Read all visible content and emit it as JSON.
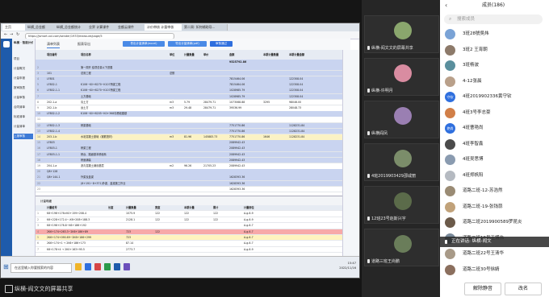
{
  "shared_screen": {
    "caption": "纵横-阎文文的屏幕共享",
    "browser": {
      "tabs": [
        "主页",
        "纵横_总金额",
        "纵横_总金额统计",
        "业界 计算课件",
        "金额云课件",
        "计价审核 计量审核",
        "第二周: 如何辅助导..."
      ],
      "url": "https://jsmart.xxl.com/sender/1933/measure/page/5"
    },
    "app": {
      "title": "纵横 · 智能计价",
      "sidebar": [
        "项目",
        "计量概况",
        "计量申报",
        "报审报表",
        "计量审核",
        "合同清单",
        "标准清单",
        "计量清单",
        "上报审核"
      ],
      "toolbar": {
        "tabs": [
          "清单列表",
          "报表导出"
        ],
        "buttons": [
          "导出计量清单(excel)",
          "导出计量清单(pdf)",
          "审核通过"
        ]
      },
      "grid": {
        "headers": [
          "项目编号",
          "项目名称",
          "单位",
          "计量数量",
          "单价",
          "金额",
          "本期计量数量",
          "本期计量金额"
        ],
        "total": "9525792.86",
        "rows": [
          {
            "code": "",
            "name": "第一周开 结项总量以下进展",
            "unit": "",
            "qty": "",
            "price": "",
            "amount": "",
            "cur": "",
            "cur_amt": "",
            "style": "blue"
          },
          {
            "code": "101",
            "name": "总则工程",
            "unit": "总额",
            "qty": "",
            "price": "",
            "amount": "",
            "cur": "",
            "cur_amt": "",
            "style": "blue"
          },
          {
            "code": "LF801",
            "name": "",
            "unit": "",
            "qty": "",
            "price": "",
            "amount": "7815464.06",
            "cur": "",
            "cur_amt": "122308.04",
            "style": "blue"
          },
          {
            "code": "LF802-1",
            "name": "K106~K0+6270~K107桥梁工程",
            "unit": "",
            "qty": "",
            "price": "",
            "amount": "7815464.06",
            "cur": "",
            "cur_amt": "122308.04",
            "style": "blue"
          },
          {
            "code": "LF802-1-1",
            "name": "K106~K0+6270~K107桥梁工程",
            "unit": "",
            "qty": "",
            "price": "",
            "amount": "1028985.79",
            "cur": "",
            "cur_amt": "122308.04",
            "style": "blue"
          },
          {
            "code": "",
            "name": "土方基础",
            "unit": "",
            "qty": "",
            "price": "",
            "amount": "1028985.79",
            "cur": "",
            "cur_amt": "122308.04",
            "style": "blue"
          },
          {
            "code": "202-1-a",
            "name": "清土方",
            "unit": "m3",
            "qty": "5.79",
            "price": "28479.71",
            "amount": "1073068.88",
            "cur": "3295",
            "cur_amt": "98046.00",
            "style": "white"
          },
          {
            "code": "202-1-b",
            "name": "运土方",
            "unit": "m3",
            "qty": "29.48",
            "price": "28479.71",
            "amount": "39536.99",
            "cur": "",
            "cur_amt": "28048.73",
            "style": "white"
          },
          {
            "code": "LF802-1-2",
            "name": "K106~K0+6205~K0+368沟槽段路基",
            "unit": "",
            "qty": "",
            "price": "",
            "amount": "",
            "cur": "",
            "cur_amt": "",
            "style": "blue"
          },
          {
            "code": "",
            "name": "",
            "unit": "",
            "qty": "",
            "price": "",
            "amount": "",
            "cur": "",
            "cur_amt": "",
            "style": "white"
          },
          {
            "code": "LF802-1-3",
            "name": "桥梁基础",
            "unit": "",
            "qty": "",
            "price": "",
            "amount": "7751770.86",
            "cur": "",
            "cur_amt": "1128231.84",
            "style": "blue"
          },
          {
            "code": "LF802-1-4",
            "name": "",
            "unit": "",
            "qty": "",
            "price": "",
            "amount": "7751770.86",
            "cur": "",
            "cur_amt": "1128231.84",
            "style": "blue"
          },
          {
            "code": "203-1-b",
            "name": "水泥混凝土基础（钢筋笼材）",
            "unit": "m3",
            "qty": "81.96",
            "price": "145883.73",
            "amount": "7751770.86",
            "cur": "1646",
            "cur_amt": "1128231.84",
            "style": "yellow"
          },
          {
            "code": "LF803",
            "name": "",
            "unit": "",
            "qty": "",
            "price": "",
            "amount": "2089942.43",
            "cur": "",
            "cur_amt": "",
            "style": "blue"
          },
          {
            "code": "LF803-1",
            "name": "桥梁工程",
            "unit": "",
            "qty": "",
            "price": "",
            "amount": "2089942.43",
            "cur": "",
            "cur_amt": "",
            "style": "blue"
          },
          {
            "code": "LF803-1-1",
            "name": "桥台、路面基本桥面系",
            "unit": "",
            "qty": "",
            "price": "",
            "amount": "2089942.43",
            "cur": "",
            "cur_amt": "",
            "style": "blue"
          },
          {
            "code": "",
            "name": "桥面铺装",
            "unit": "",
            "qty": "",
            "price": "",
            "amount": "2089942.43",
            "cur": "",
            "cur_amt": "",
            "style": "blue"
          },
          {
            "code": "204-1-a",
            "name": "沥青混凝土铺设基层",
            "unit": "m2",
            "qty": "96.26",
            "price": "21705.23",
            "amount": "2089942.43",
            "cur": "",
            "cur_amt": "",
            "style": "white"
          },
          {
            "code": "Q8+128",
            "name": "",
            "unit": "",
            "qty": "",
            "price": "",
            "amount": "",
            "cur": "",
            "cur_amt": "",
            "style": "blue"
          },
          {
            "code": "Q8+144-1",
            "name": "外梁及盖梁",
            "unit": "",
            "qty": "",
            "price": "",
            "amount": "1628393.36",
            "cur": "",
            "cur_amt": "",
            "style": "blue"
          },
          {
            "code": "",
            "name": "(8+191~8+371)外梁、盖梁施工作业",
            "unit": "",
            "qty": "",
            "price": "",
            "amount": "1628393.36",
            "cur": "",
            "cur_amt": "",
            "style": "blue"
          },
          {
            "code": "",
            "name": "",
            "unit": "",
            "qty": "",
            "price": "",
            "amount": "1628393.36",
            "cur": "",
            "cur_amt": "",
            "style": "white"
          }
        ]
      },
      "sub_grid": {
        "label": "计量明细",
        "headers": [
          "计量桩号",
          "长度",
          "计量数量",
          "宽度",
          "本期计量",
          "累计",
          "计量部位"
        ],
        "rows": [
          {
            "a": "K6+196+176>K0+159+208.4",
            "b": "",
            "c": "1075.9",
            "d": "122",
            "e": "122",
            "f": "122",
            "g": "A-g-6-9",
            "style": "white"
          },
          {
            "a": "K6+228+172.4~-K6+208+188.3",
            "b": "",
            "c": "2128.1",
            "d": "122",
            "e": "122",
            "f": "122",
            "g": "A-g-6-9",
            "style": "white"
          },
          {
            "a": "K6+196+176.8~K6+186+192",
            "b": "",
            "c": "",
            "d": "",
            "e": "",
            "f": "",
            "g": "A-g-6-7",
            "style": "white"
          },
          {
            "a": "2K6+174+263.3~2K6+186+89",
            "b": "",
            "c": "723",
            "d": "122",
            "e": "",
            "f": "",
            "g": "A-g-6-7",
            "style": "red"
          },
          {
            "a": "2K6+174+090.69~2K6+186+299",
            "b": "",
            "c": "723",
            "d": "",
            "e": "",
            "f": "",
            "g": "A-g-6-7",
            "style": "yellow"
          },
          {
            "a": "2K6+174+1 → 2K6+186+173",
            "b": "",
            "c": "87.14",
            "d": "",
            "e": "",
            "f": "",
            "g": "A-g-6-7",
            "style": "white"
          },
          {
            "a": "K6+178+4 → 2K0+163+95.5",
            "b": "",
            "c": "2773.7",
            "d": "",
            "e": "",
            "f": "",
            "g": "A-g-6-9",
            "style": "white"
          }
        ]
      }
    },
    "taskbar": {
      "search_placeholder": "在这里输入你要搜索的内容",
      "time": "15:47",
      "date": "2022/11/16"
    }
  },
  "video_tiles": [
    {
      "name": "纵横-阎文文的屏幕共享",
      "color": "#8aa66d"
    },
    {
      "name": "纵横-许明月",
      "color": "#d98ca1"
    },
    {
      "name": "纵横阎凤",
      "color": "#9a7fb2"
    },
    {
      "name": "4班2019903429邵咸丽",
      "color": "#7b8d6a"
    },
    {
      "name": "12班23号赵斯兴字",
      "color": "#5b6b4a"
    },
    {
      "name": "道路三班王尚鹏",
      "color": "#6a7d5a"
    }
  ],
  "members_panel": {
    "title": "成员(186)",
    "search_placeholder": "搜索成员",
    "members": [
      {
        "name": "3班28號吳炜",
        "avatar": "",
        "color": "#7aa3d6"
      },
      {
        "name": "3班2 王宵朝",
        "avatar": "",
        "color": "#8d7a6a"
      },
      {
        "name": "3班杨波",
        "avatar": "",
        "color": "#5a8f9d"
      },
      {
        "name": "4-12张晨",
        "avatar": "",
        "color": "#b9a08a"
      },
      {
        "name": "4班2019902336黄守钦",
        "avatar": "守钦",
        "color": "#2f6fde"
      },
      {
        "name": "4班3号李志豪",
        "avatar": "",
        "color": "#d17f48"
      },
      {
        "name": "4班曹艳尚",
        "avatar": "艳尚",
        "color": "#2f6fde"
      },
      {
        "name": "4班李智鑫",
        "avatar": "",
        "color": "#4b4b4b"
      },
      {
        "name": "4班吴思博",
        "avatar": "",
        "color": "#8a9bb0"
      },
      {
        "name": "4班郑帆阳",
        "avatar": "",
        "color": "#b5bac1"
      },
      {
        "name": "道路二班-12-苏浩然",
        "avatar": "",
        "color": "#9a8b74"
      },
      {
        "name": "道路二班-19-张钱蒜",
        "avatar": "",
        "color": "#c1a27a"
      },
      {
        "name": "道路二班2019900589罗昆炎",
        "avatar": "",
        "color": "#6b5a4a"
      },
      {
        "name": "道路二班16号王博伟",
        "avatar": "",
        "color": "#7a8a9a"
      },
      {
        "name": "道路二班22号王清华",
        "avatar": "",
        "color": "#a89a88"
      },
      {
        "name": "道路二班30号徐婧",
        "avatar": "",
        "color": "#8b6f5e"
      }
    ],
    "toast": "正在讲话: 纵横-阎文",
    "buttons": {
      "unmute_all": "解除静音",
      "rename": "改名"
    }
  }
}
